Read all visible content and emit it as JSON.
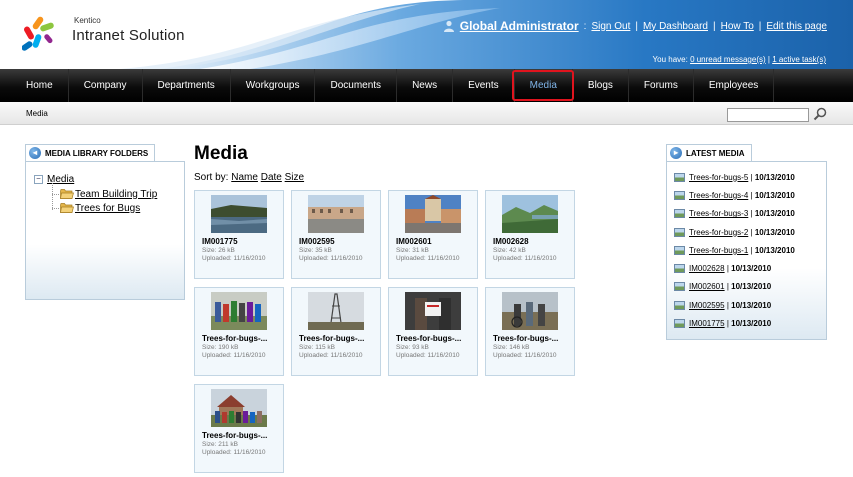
{
  "brand": {
    "small": "Kentico",
    "big": "Intranet Solution"
  },
  "header": {
    "user_name": "Global Administrator",
    "colon": ":",
    "links": [
      "Sign Out",
      "My Dashboard",
      "How To",
      "Edit this page"
    ],
    "separator": "|",
    "messages_prefix": "You have:",
    "messages_link": "0 unread message(s)",
    "tasks_link": "1 active task(s)"
  },
  "nav": {
    "items": [
      "Home",
      "Company",
      "Departments",
      "Workgroups",
      "Documents",
      "News",
      "Events",
      "Media",
      "Blogs",
      "Forums",
      "Employees"
    ],
    "active_index": 7
  },
  "breadcrumb": "Media",
  "search": {
    "value": "",
    "placeholder": ""
  },
  "folders": {
    "title": "MEDIA LIBRARY FOLDERS",
    "root": "Media",
    "toggle": "−",
    "children": [
      "Team Building Trip",
      "Trees for Bugs"
    ]
  },
  "main": {
    "title": "Media",
    "sort_label": "Sort by:",
    "sort_options": [
      "Name",
      "Date",
      "Size"
    ]
  },
  "tiles": [
    {
      "name": "IM001775",
      "size": "Size: 26 kB",
      "uploaded": "Uploaded: 11/16/2010"
    },
    {
      "name": "IM002595",
      "size": "Size: 35 kB",
      "uploaded": "Uploaded: 11/16/2010"
    },
    {
      "name": "IM002601",
      "size": "Size: 31 kB",
      "uploaded": "Uploaded: 11/16/2010"
    },
    {
      "name": "IM002628",
      "size": "Size: 42 kB",
      "uploaded": "Uploaded: 11/16/2010"
    },
    {
      "name": "Trees-for-bugs-...",
      "size": "Size: 190 kB",
      "uploaded": "Uploaded: 11/16/2010"
    },
    {
      "name": "Trees-for-bugs-...",
      "size": "Size: 115 kB",
      "uploaded": "Uploaded: 11/16/2010"
    },
    {
      "name": "Trees-for-bugs-...",
      "size": "Size: 93 kB",
      "uploaded": "Uploaded: 11/16/2010"
    },
    {
      "name": "Trees-for-bugs-...",
      "size": "Size: 146 kB",
      "uploaded": "Uploaded: 11/16/2010"
    },
    {
      "name": "Trees-for-bugs-...",
      "size": "Size: 211 kB",
      "uploaded": "Uploaded: 11/16/2010"
    }
  ],
  "latest": {
    "title": "LATEST MEDIA",
    "separator": " | ",
    "items": [
      {
        "name": "Trees-for-bugs-5",
        "date": "10/13/2010"
      },
      {
        "name": "Trees-for-bugs-4",
        "date": "10/13/2010"
      },
      {
        "name": "Trees-for-bugs-3",
        "date": "10/13/2010"
      },
      {
        "name": "Trees-for-bugs-2",
        "date": "10/13/2010"
      },
      {
        "name": "Trees-for-bugs-1",
        "date": "10/13/2010"
      },
      {
        "name": "IM002628",
        "date": "10/13/2010"
      },
      {
        "name": "IM002601",
        "date": "10/13/2010"
      },
      {
        "name": "IM002595",
        "date": "10/13/2010"
      },
      {
        "name": "IM001775",
        "date": "10/13/2010"
      }
    ]
  },
  "colors": {
    "nav_bg": "#000000",
    "active_nav_text": "#7fb4e8",
    "active_highlight": "#e0141e",
    "header_blue": "#1f6db8",
    "panel_border": "#b9ccdb",
    "tile_bg": "#f2f8fc"
  },
  "icons": {
    "user": "user-icon",
    "search": "search-icon",
    "folder": "folder-icon",
    "image": "image-icon",
    "panel": "arrow-circle-icon",
    "logo": "kentico-logo"
  }
}
